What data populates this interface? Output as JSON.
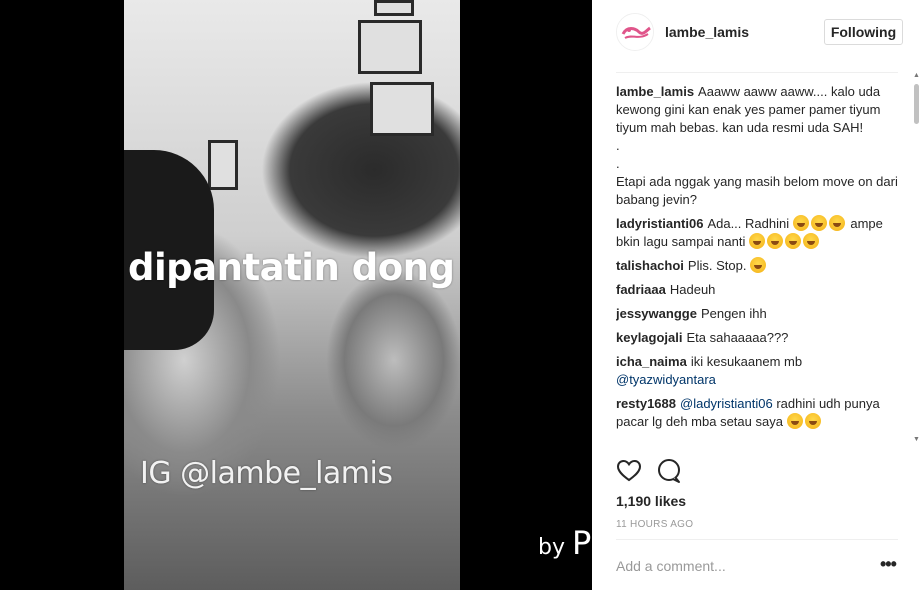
{
  "post": {
    "video_overlay_text": "dipantatin dong",
    "video_watermark": "IG @lambe_lamis",
    "video_byline_small": "by",
    "video_byline_big": "P"
  },
  "header": {
    "username": "lambe_lamis",
    "follow_label": "Following"
  },
  "caption": {
    "username": "lambe_lamis",
    "text_lines": [
      "Aaaww aaww aaww.... kalo uda kewong gini kan enak yes pamer pamer tiyum tiyum mah bebas. kan uda resmi uda SAH!",
      ".",
      ".",
      "Etapi ada nggak yang masih belom move on dari babang jevin?"
    ]
  },
  "comments": [
    {
      "username": "ladyristianti06",
      "text": "Ada... Radhini",
      "text2": "ampe bkin lagu sampai nanti"
    },
    {
      "username": "talishachoi",
      "text": "Plis. Stop."
    },
    {
      "username": "fadriaaa",
      "text": "Hadeuh"
    },
    {
      "username": "jessywangge",
      "text": "Pengen ihh"
    },
    {
      "username": "keylagojali",
      "text": "Eta sahaaaaa???"
    },
    {
      "username": "icha_naima",
      "text": "iki kesukaanem mb",
      "mention": "@tyazwidyantara"
    },
    {
      "username": "resty1688",
      "mention": "@ladyristianti06",
      "text": "radhini udh punya pacar lg deh mba setau saya"
    }
  ],
  "actions": {
    "like_icon": "heart-icon",
    "comment_icon": "comment-bubble-icon",
    "likes": "1,190 likes",
    "time_ago": "11 HOURS AGO"
  },
  "add_comment": {
    "placeholder": "Add a comment...",
    "more": "•••"
  },
  "colors": {
    "text": "#262626",
    "muted": "#999999",
    "mention": "#003569",
    "border": "#efefef",
    "media_bg": "#000000"
  }
}
